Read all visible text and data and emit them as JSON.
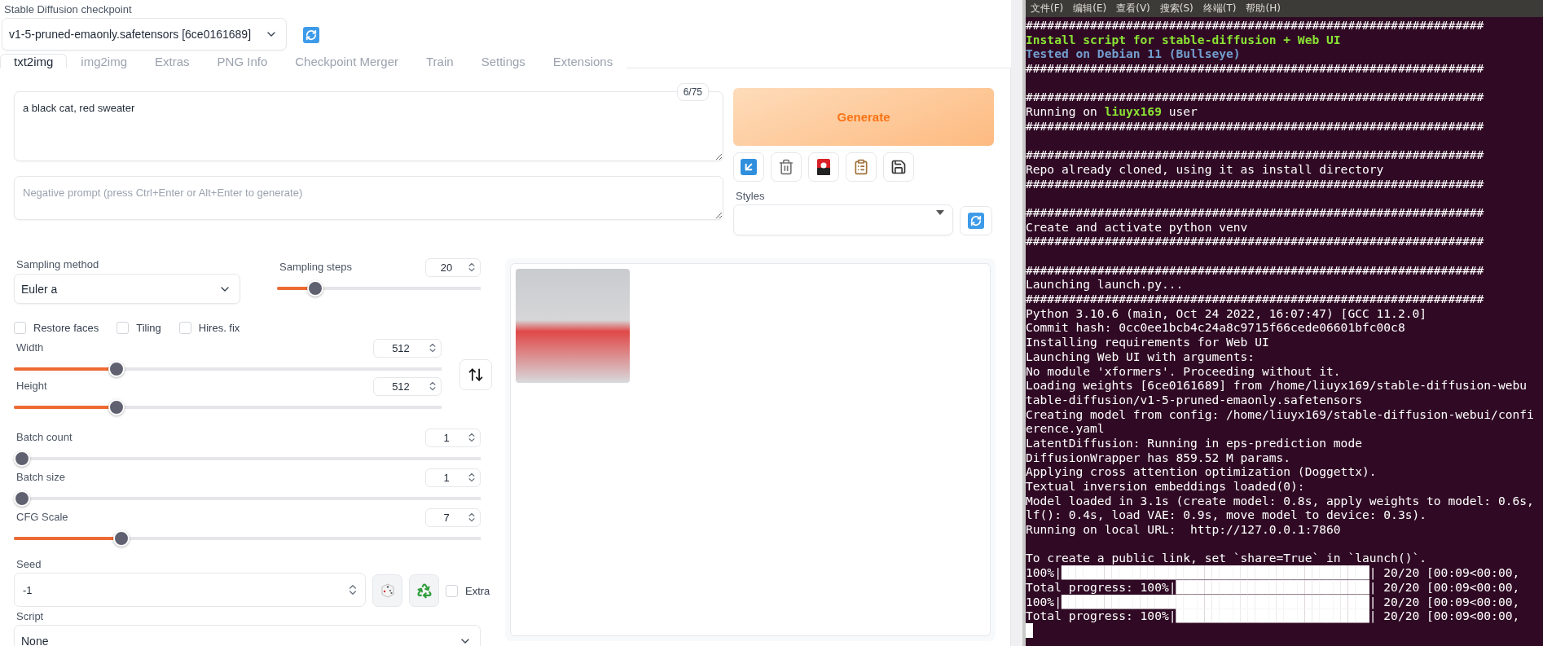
{
  "checkpoint": {
    "label": "Stable Diffusion checkpoint",
    "value": "v1-5-pruned-emaonly.safetensors [6ce0161689]"
  },
  "tabs": [
    {
      "label": "txt2img",
      "selected": true
    },
    {
      "label": "img2img",
      "selected": false
    },
    {
      "label": "Extras",
      "selected": false
    },
    {
      "label": "PNG Info",
      "selected": false
    },
    {
      "label": "Checkpoint Merger",
      "selected": false
    },
    {
      "label": "Train",
      "selected": false
    },
    {
      "label": "Settings",
      "selected": false
    },
    {
      "label": "Extensions",
      "selected": false
    }
  ],
  "prompt": {
    "value": "a black cat, red sweater",
    "token_count": "6/75"
  },
  "negative_prompt": {
    "placeholder": "Negative prompt (press Ctrl+Enter or Alt+Enter to generate)"
  },
  "generate_button": "Generate",
  "styles": {
    "label": "Styles"
  },
  "sampling_method": {
    "label": "Sampling method",
    "value": "Euler a"
  },
  "sampling_steps": {
    "label": "Sampling steps",
    "value": "20",
    "level": 0.16
  },
  "options": [
    {
      "label": "Restore faces",
      "checked": false
    },
    {
      "label": "Tiling",
      "checked": false
    },
    {
      "label": "Hires. fix",
      "checked": false
    }
  ],
  "width": {
    "label": "Width",
    "value": "512",
    "level": 0.23
  },
  "height": {
    "label": "Height",
    "value": "512",
    "level": 0.23
  },
  "batch_count": {
    "label": "Batch count",
    "value": "1",
    "level": 0
  },
  "batch_size": {
    "label": "Batch size",
    "value": "1",
    "level": 0
  },
  "cfg_scale": {
    "label": "CFG Scale",
    "value": "7",
    "level": 0.22
  },
  "seed": {
    "label": "Seed",
    "value": "-1",
    "extra": {
      "label": "Extra",
      "checked": false
    }
  },
  "script": {
    "label": "Script",
    "value": "None"
  },
  "terminal": {
    "menu": [
      "文件(F)",
      "编辑(E)",
      "查看(V)",
      "搜索(S)",
      "终端(T)",
      "帮助(H)"
    ],
    "lines": [
      {
        "kind": "text",
        "parts": [
          {
            "text": "################################################################"
          }
        ]
      },
      {
        "kind": "text",
        "parts": [
          {
            "text": "Install script for stable-diffusion + Web UI",
            "color": "#8ae234"
          }
        ]
      },
      {
        "kind": "text",
        "parts": [
          {
            "text": "Tested on Debian 11 (Bullseye)",
            "color": "#729fcf"
          }
        ]
      },
      {
        "kind": "text",
        "parts": [
          {
            "text": "################################################################"
          }
        ]
      },
      {
        "kind": "blank"
      },
      {
        "kind": "text",
        "parts": [
          {
            "text": "################################################################"
          }
        ]
      },
      {
        "kind": "text",
        "parts": [
          {
            "text": "Running on "
          },
          {
            "text": "liuyx169",
            "color": "#8ae234"
          },
          {
            "text": " user"
          }
        ]
      },
      {
        "kind": "text",
        "parts": [
          {
            "text": "################################################################"
          }
        ]
      },
      {
        "kind": "blank"
      },
      {
        "kind": "text",
        "parts": [
          {
            "text": "################################################################"
          }
        ]
      },
      {
        "kind": "text",
        "parts": [
          {
            "text": "Repo already cloned, using it as install directory"
          }
        ]
      },
      {
        "kind": "text",
        "parts": [
          {
            "text": "################################################################"
          }
        ]
      },
      {
        "kind": "blank"
      },
      {
        "kind": "text",
        "parts": [
          {
            "text": "################################################################"
          }
        ]
      },
      {
        "kind": "text",
        "parts": [
          {
            "text": "Create and activate python venv"
          }
        ]
      },
      {
        "kind": "text",
        "parts": [
          {
            "text": "################################################################"
          }
        ]
      },
      {
        "kind": "blank"
      },
      {
        "kind": "text",
        "parts": [
          {
            "text": "################################################################"
          }
        ]
      },
      {
        "kind": "text",
        "parts": [
          {
            "text": "Launching launch.py..."
          }
        ]
      },
      {
        "kind": "text",
        "parts": [
          {
            "text": "################################################################"
          }
        ]
      },
      {
        "kind": "text",
        "parts": [
          {
            "text": "Python 3.10.6 (main, Oct 24 2022, 16:07:47) [GCC 11.2.0]"
          }
        ]
      },
      {
        "kind": "text",
        "parts": [
          {
            "text": "Commit hash: 0cc0ee1bcb4c24a8c9715f66cede06601bfc00c8"
          }
        ]
      },
      {
        "kind": "text",
        "parts": [
          {
            "text": "Installing requirements for Web UI"
          }
        ]
      },
      {
        "kind": "text",
        "parts": [
          {
            "text": "Launching Web UI with arguments:"
          }
        ]
      },
      {
        "kind": "text",
        "parts": [
          {
            "text": "No module 'xformers'. Proceeding without it."
          }
        ]
      },
      {
        "kind": "text",
        "parts": [
          {
            "text": "Loading weights [6ce0161689] from /home/liuyx169/stable-diffusion-webu"
          }
        ]
      },
      {
        "kind": "text",
        "parts": [
          {
            "text": "table-diffusion/v1-5-pruned-emaonly.safetensors"
          }
        ]
      },
      {
        "kind": "text",
        "parts": [
          {
            "text": "Creating model from config: /home/liuyx169/stable-diffusion-webui/confi"
          }
        ]
      },
      {
        "kind": "text",
        "parts": [
          {
            "text": "erence.yaml"
          }
        ]
      },
      {
        "kind": "text",
        "parts": [
          {
            "text": "LatentDiffusion: Running in eps-prediction mode"
          }
        ]
      },
      {
        "kind": "text",
        "parts": [
          {
            "text": "DiffusionWrapper has 859.52 M params."
          }
        ]
      },
      {
        "kind": "text",
        "parts": [
          {
            "text": "Applying cross attention optimization (Doggettx)."
          }
        ]
      },
      {
        "kind": "text",
        "parts": [
          {
            "text": "Textual inversion embeddings loaded(0):"
          }
        ]
      },
      {
        "kind": "text",
        "parts": [
          {
            "text": "Model loaded in 3.1s (create model: 0.8s, apply weights to model: 0.6s,"
          }
        ]
      },
      {
        "kind": "text",
        "parts": [
          {
            "text": "lf(): 0.4s, load VAE: 0.9s, move model to device: 0.3s)."
          }
        ]
      },
      {
        "kind": "text",
        "parts": [
          {
            "text": "Running on local URL:  http://127.0.0.1:7860"
          }
        ]
      },
      {
        "kind": "blank"
      },
      {
        "kind": "text",
        "parts": [
          {
            "text": "To create a public link, set `share=True` in `launch()`."
          }
        ]
      },
      {
        "kind": "text",
        "parts": [
          {
            "text": "100%|███████████████████████████████████████████| 20/20 [00:09<00:00,"
          }
        ]
      },
      {
        "kind": "text",
        "parts": [
          {
            "text": "Total progress: 100%|███████████████████████████| 20/20 [00:09<00:00,"
          }
        ]
      },
      {
        "kind": "text",
        "parts": [
          {
            "text": "100%|███████████████████████████████████████████| 20/20 [00:09<00:00,"
          }
        ]
      },
      {
        "kind": "text",
        "parts": [
          {
            "text": "Total progress: 100%|███████████████████████████| 20/20 [00:09<00:00,"
          }
        ]
      },
      {
        "kind": "cursor"
      }
    ]
  }
}
